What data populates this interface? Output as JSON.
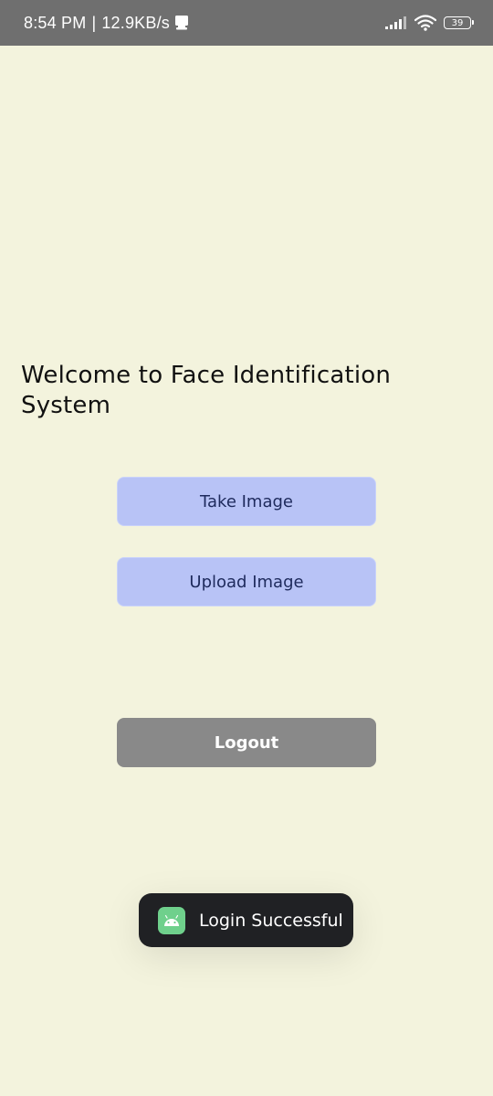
{
  "status_bar": {
    "time": "8:54 PM",
    "separator": "|",
    "network_speed": "12.9KB/s",
    "notification_icon": "screenshot-icon",
    "signal_icon": "cell-signal-icon",
    "wifi_icon": "wifi-icon",
    "battery_level": "39"
  },
  "main": {
    "welcome_text": "Welcome to Face Identification System",
    "take_image_label": "Take Image",
    "upload_image_label": "Upload Image",
    "logout_label": "Logout"
  },
  "toast": {
    "icon": "android-icon",
    "message": "Login Successful"
  },
  "colors": {
    "background": "#f3f3dd",
    "status_bar": "#6f6f6f",
    "primary_button": "#b8c3f6",
    "primary_button_text": "#1e2a5c",
    "logout_button": "#898989",
    "toast_background": "#202124",
    "toast_icon": "#6fd08c"
  }
}
